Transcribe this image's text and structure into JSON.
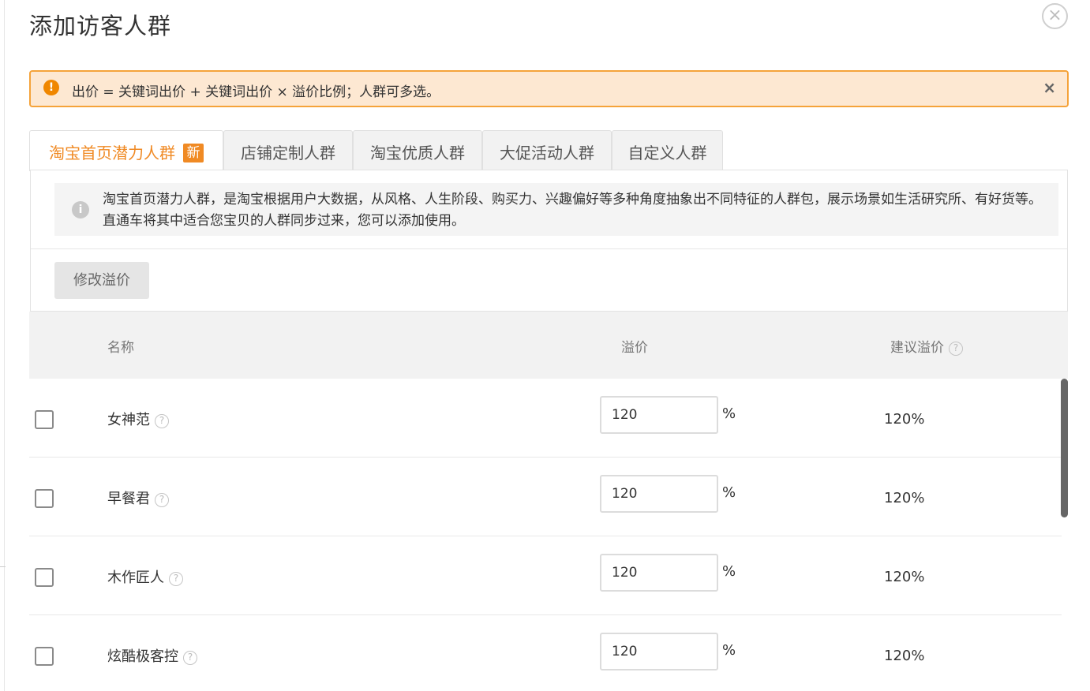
{
  "dialog": {
    "title": "添加访客人群",
    "close_icon": "×"
  },
  "alert": {
    "icon": "!",
    "text": "出价 = 关键词出价 + 关键词出价 × 溢价比例；人群可多选。",
    "close_icon": "×"
  },
  "tabs": [
    {
      "label": "淘宝首页潜力人群",
      "badge": "新",
      "active": true
    },
    {
      "label": "店铺定制人群",
      "active": false
    },
    {
      "label": "淘宝优质人群",
      "active": false
    },
    {
      "label": "大促活动人群",
      "active": false
    },
    {
      "label": "自定义人群",
      "active": false
    }
  ],
  "info": {
    "icon": "i",
    "text": "淘宝首页潜力人群，是淘宝根据用户大数据，从风格、人生阶段、购买力、兴趣偏好等多种角度抽象出不同特征的人群包，展示场景如生活研究所、有好货等。直通车将其中适合您宝贝的人群同步过来，您可以添加使用。"
  },
  "toolbar": {
    "modify_label": "修改溢价"
  },
  "table": {
    "headers": {
      "name": "名称",
      "premium": "溢价",
      "suggested": "建议溢价"
    },
    "help_icon": "?",
    "percent_sign": "%",
    "rows": [
      {
        "name": "女神范",
        "premium": "120",
        "suggested": "120%",
        "checked": false
      },
      {
        "name": "早餐君",
        "premium": "120",
        "suggested": "120%",
        "checked": false
      },
      {
        "name": "木作匠人",
        "premium": "120",
        "suggested": "120%",
        "checked": false
      },
      {
        "name": "炫酷极客控",
        "premium": "120",
        "suggested": "120%",
        "checked": false
      }
    ]
  },
  "colors": {
    "accent": "#f08a24",
    "alert_bg": "#fde8d2",
    "alert_border": "#f5a33a",
    "alert_icon": "#f08700"
  }
}
